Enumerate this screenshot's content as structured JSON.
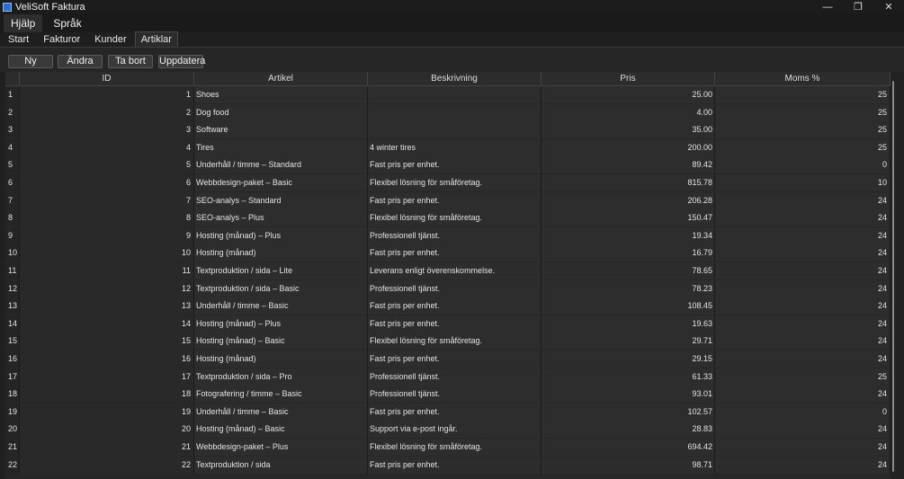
{
  "window": {
    "title": "VeliSoft Faktura",
    "controls": [
      "—",
      "❐",
      "✕"
    ]
  },
  "menu": [
    {
      "label": "Hjälp"
    },
    {
      "label": "Språk"
    }
  ],
  "tabs": [
    {
      "label": "Start"
    },
    {
      "label": "Fakturor"
    },
    {
      "label": "Kunder"
    },
    {
      "label": "Artiklar"
    }
  ],
  "toolbar": {
    "new": "Ny",
    "edit": "Ändra",
    "delete": "Ta bort",
    "refresh": "Uppdatera"
  },
  "table": {
    "headers": {
      "id": "ID",
      "artikel": "Artikel",
      "beskrivning": "Beskrivning",
      "pris": "Pris",
      "moms": "Moms %"
    },
    "rows": [
      {
        "n": "1",
        "id": "1",
        "artikel": "Shoes",
        "beskrivning": "",
        "pris": "25.00",
        "moms": "25"
      },
      {
        "n": "2",
        "id": "2",
        "artikel": "Dog food",
        "beskrivning": "",
        "pris": "4.00",
        "moms": "25"
      },
      {
        "n": "3",
        "id": "3",
        "artikel": "Software",
        "beskrivning": "",
        "pris": "35.00",
        "moms": "25"
      },
      {
        "n": "4",
        "id": "4",
        "artikel": "Tires",
        "beskrivning": "4 winter tires",
        "pris": "200.00",
        "moms": "25"
      },
      {
        "n": "5",
        "id": "5",
        "artikel": "Underhåll / timme – Standard",
        "beskrivning": "Fast pris per enhet.",
        "pris": "89.42",
        "moms": "0"
      },
      {
        "n": "6",
        "id": "6",
        "artikel": "Webbdesign-paket – Basic",
        "beskrivning": "Flexibel lösning för småföretag.",
        "pris": "815.78",
        "moms": "10"
      },
      {
        "n": "7",
        "id": "7",
        "artikel": "SEO-analys – Standard",
        "beskrivning": "Fast pris per enhet.",
        "pris": "206.28",
        "moms": "24"
      },
      {
        "n": "8",
        "id": "8",
        "artikel": "SEO-analys – Plus",
        "beskrivning": "Flexibel lösning för småföretag.",
        "pris": "150.47",
        "moms": "24"
      },
      {
        "n": "9",
        "id": "9",
        "artikel": "Hosting (månad) – Plus",
        "beskrivning": "Professionell tjänst.",
        "pris": "19.34",
        "moms": "24"
      },
      {
        "n": "10",
        "id": "10",
        "artikel": "Hosting (månad)",
        "beskrivning": "Fast pris per enhet.",
        "pris": "16.79",
        "moms": "24"
      },
      {
        "n": "11",
        "id": "11",
        "artikel": "Textproduktion / sida – Lite",
        "beskrivning": "Leverans enligt överenskommelse.",
        "pris": "78.65",
        "moms": "24"
      },
      {
        "n": "12",
        "id": "12",
        "artikel": "Textproduktion / sida – Basic",
        "beskrivning": "Professionell tjänst.",
        "pris": "78.23",
        "moms": "24"
      },
      {
        "n": "13",
        "id": "13",
        "artikel": "Underhåll / timme – Basic",
        "beskrivning": "Fast pris per enhet.",
        "pris": "108.45",
        "moms": "24"
      },
      {
        "n": "14",
        "id": "14",
        "artikel": "Hosting (månad) – Plus",
        "beskrivning": "Fast pris per enhet.",
        "pris": "19.63",
        "moms": "24"
      },
      {
        "n": "15",
        "id": "15",
        "artikel": "Hosting (månad) – Basic",
        "beskrivning": "Flexibel lösning för småföretag.",
        "pris": "29.71",
        "moms": "24"
      },
      {
        "n": "16",
        "id": "16",
        "artikel": "Hosting (månad)",
        "beskrivning": "Fast pris per enhet.",
        "pris": "29.15",
        "moms": "24"
      },
      {
        "n": "17",
        "id": "17",
        "artikel": "Textproduktion / sida – Pro",
        "beskrivning": "Professionell tjänst.",
        "pris": "61.33",
        "moms": "25"
      },
      {
        "n": "18",
        "id": "18",
        "artikel": "Fotografering / timme – Basic",
        "beskrivning": "Professionell tjänst.",
        "pris": "93.01",
        "moms": "24"
      },
      {
        "n": "19",
        "id": "19",
        "artikel": "Underhåll / timme – Basic",
        "beskrivning": "Fast pris per enhet.",
        "pris": "102.57",
        "moms": "0"
      },
      {
        "n": "20",
        "id": "20",
        "artikel": "Hosting (månad) – Basic",
        "beskrivning": "Support via e-post ingår.",
        "pris": "28.83",
        "moms": "24"
      },
      {
        "n": "21",
        "id": "21",
        "artikel": "Webbdesign-paket – Plus",
        "beskrivning": "Flexibel lösning för småföretag.",
        "pris": "694.42",
        "moms": "24"
      },
      {
        "n": "22",
        "id": "22",
        "artikel": "Textproduktion / sida",
        "beskrivning": "Fast pris per enhet.",
        "pris": "98.71",
        "moms": "24"
      }
    ]
  }
}
